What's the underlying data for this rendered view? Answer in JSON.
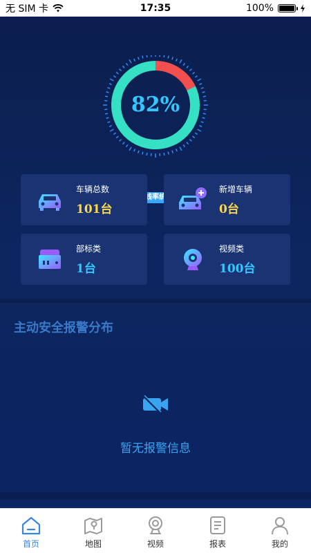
{
  "status_bar": {
    "carrier": "无 SIM 卡",
    "time": "17:35",
    "battery": "100%"
  },
  "gauge": {
    "value": "82%",
    "online_fraction": 0.82,
    "badge": "在线率统计",
    "colors": {
      "online": "#36e0c4",
      "offline": "#f2504e",
      "ticks": "#2f8cff"
    }
  },
  "cards": [
    {
      "label": "车辆总数",
      "value": "101台",
      "icon": "car-icon"
    },
    {
      "label": "新增车辆",
      "value": "0台",
      "icon": "car-add-icon"
    },
    {
      "label": "部标类",
      "value": "1台",
      "icon": "device-box-icon"
    },
    {
      "label": "视频类",
      "value": "100台",
      "icon": "webcam-icon"
    }
  ],
  "section": {
    "title": "主动安全报警分布",
    "empty_text": "暂无报警信息",
    "empty_icon": "video-off-icon"
  },
  "tabs": [
    {
      "label": "首页",
      "icon": "home-icon",
      "active": true
    },
    {
      "label": "地图",
      "icon": "map-icon",
      "active": false
    },
    {
      "label": "视频",
      "icon": "camera-icon",
      "active": false
    },
    {
      "label": "报表",
      "icon": "report-icon",
      "active": false
    },
    {
      "label": "我的",
      "icon": "profile-icon",
      "active": false
    }
  ]
}
